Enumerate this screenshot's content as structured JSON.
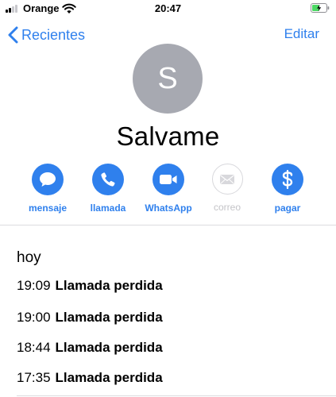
{
  "status_bar": {
    "carrier": "Orange",
    "time": "20:47",
    "icons": [
      "signal-icon",
      "wifi-icon",
      "battery-charging-icon"
    ],
    "battery_color": "#4cd964"
  },
  "nav": {
    "back_label": "Recientes",
    "edit_label": "Editar"
  },
  "contact": {
    "initial": "S",
    "name": "Salvame"
  },
  "actions": [
    {
      "label": "mensaje",
      "icon": "message-bubble-icon",
      "enabled": true
    },
    {
      "label": "llamada",
      "icon": "phone-icon",
      "enabled": true
    },
    {
      "label": "WhatsApp",
      "icon": "video-camera-icon",
      "enabled": true
    },
    {
      "label": "correo",
      "icon": "envelope-icon",
      "enabled": false
    },
    {
      "label": "pagar",
      "icon": "dollar-icon",
      "enabled": true
    }
  ],
  "calls": {
    "section_title": "hoy",
    "entries": [
      {
        "time": "19:09",
        "description": "Llamada perdida"
      },
      {
        "time": "19:00",
        "description": "Llamada perdida"
      },
      {
        "time": "18:44",
        "description": "Llamada perdida"
      },
      {
        "time": "17:35",
        "description": "Llamada perdida"
      }
    ]
  },
  "colors": {
    "accent": "#2f80ed",
    "avatar_bg": "#a7a9b1",
    "disabled": "#c4c4c8"
  }
}
